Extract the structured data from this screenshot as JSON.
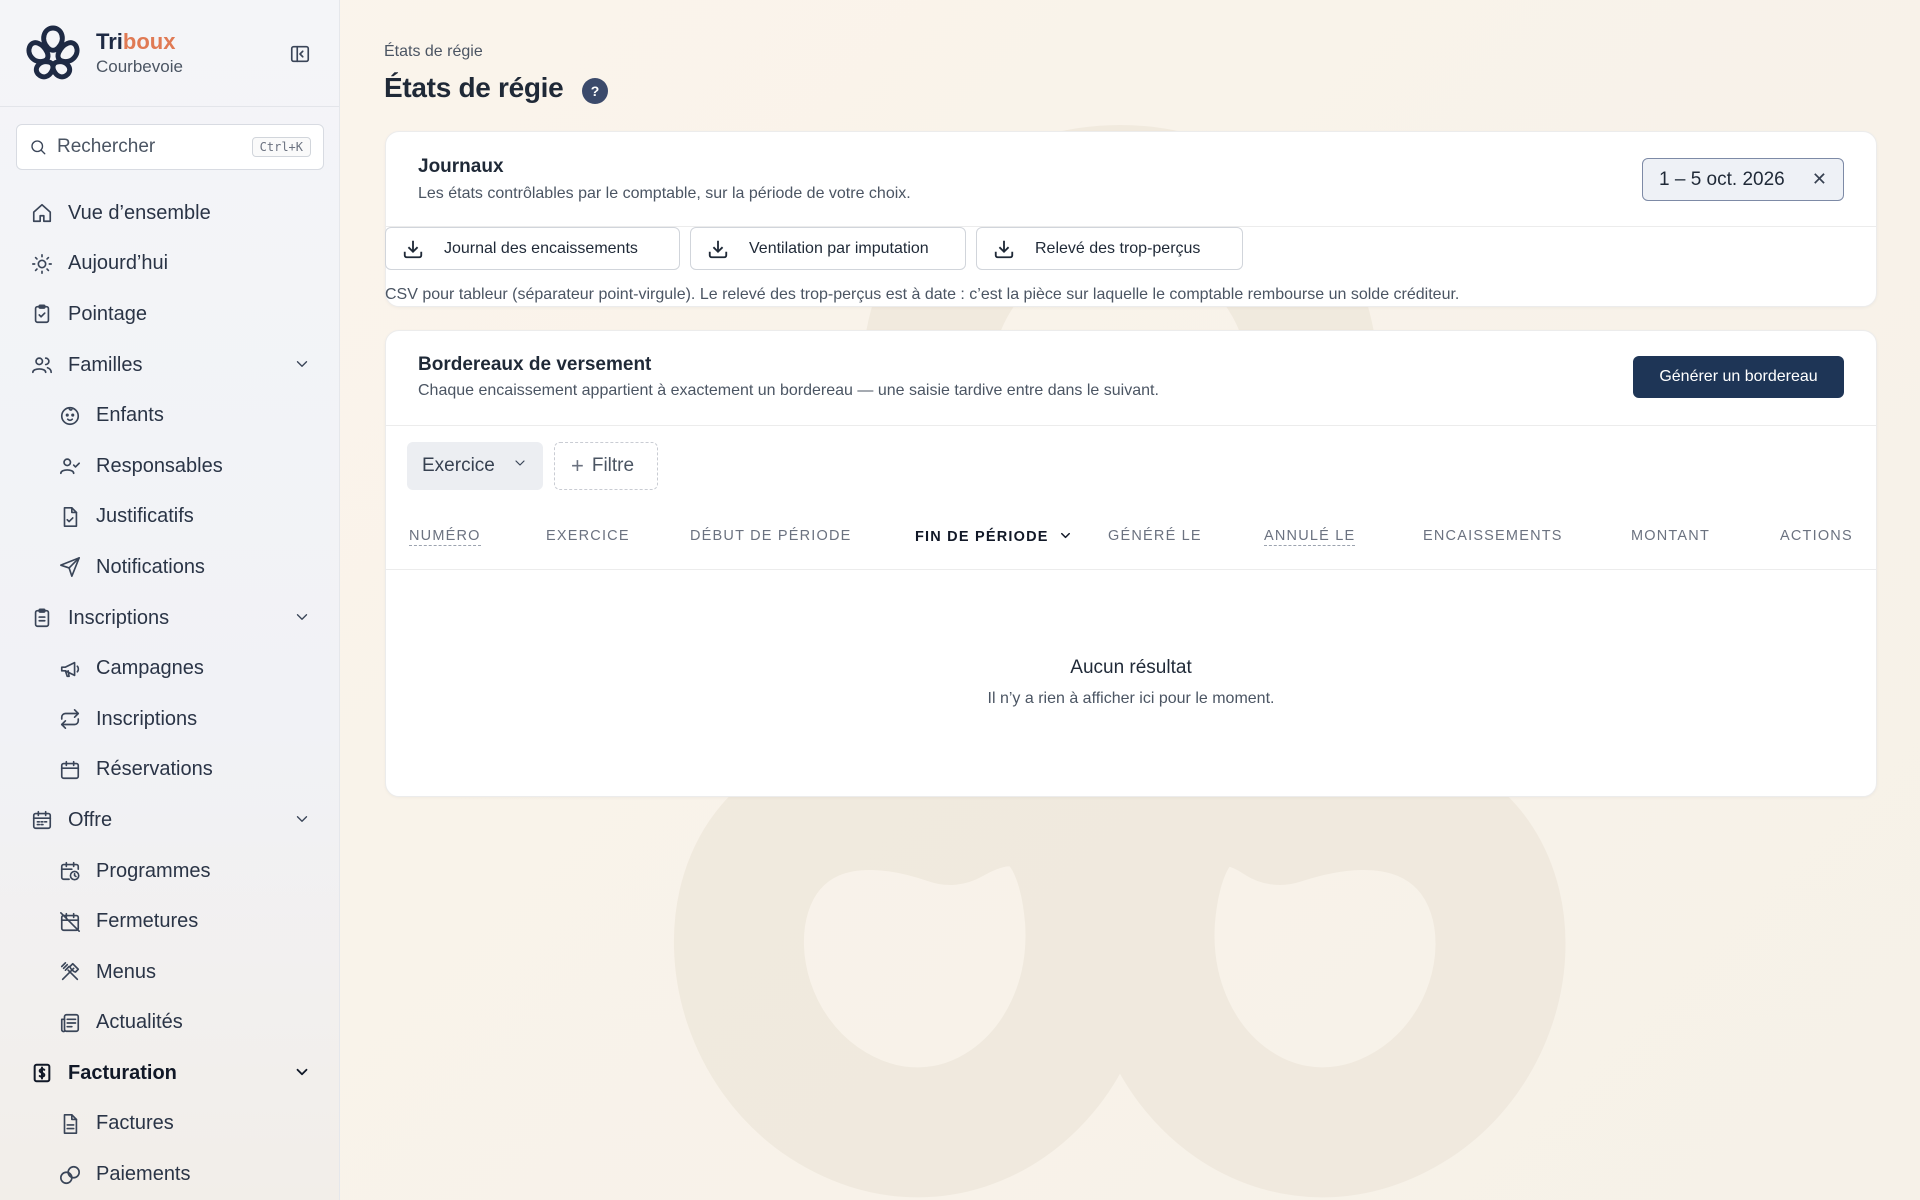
{
  "brand": {
    "name_main": "Tri",
    "name_accent": "boux",
    "city": "Courbevoie"
  },
  "search": {
    "label": "Rechercher",
    "shortcut": "Ctrl+K"
  },
  "sidebar": {
    "items": [
      {
        "label": "Vue d’ensemble"
      },
      {
        "label": "Aujourd’hui"
      },
      {
        "label": "Pointage"
      },
      {
        "label": "Familles"
      },
      {
        "label": "Enfants"
      },
      {
        "label": "Responsables"
      },
      {
        "label": "Justificatifs"
      },
      {
        "label": "Notifications"
      },
      {
        "label": "Inscriptions"
      },
      {
        "label": "Campagnes"
      },
      {
        "label": "Inscriptions"
      },
      {
        "label": "Réservations"
      },
      {
        "label": "Offre"
      },
      {
        "label": "Programmes"
      },
      {
        "label": "Fermetures"
      },
      {
        "label": "Menus"
      },
      {
        "label": "Actualités"
      },
      {
        "label": "Facturation"
      },
      {
        "label": "Factures"
      },
      {
        "label": "Paiements"
      }
    ]
  },
  "header": {
    "breadcrumb": "États de régie",
    "title": "États de régie",
    "help": "?"
  },
  "journaux": {
    "title": "Journaux",
    "subtitle": "Les états contrôlables par le comptable, sur la période de votre choix.",
    "date_range": "1 – 5 oct. 2026",
    "clear": "✕",
    "buttons": [
      "Journal des encaissements",
      "Ventilation par imputation",
      "Relevé des trop-perçus"
    ],
    "note": "CSV pour tableur (séparateur point-virgule). Le relevé des trop-perçus est à date : c’est la pièce sur laquelle le comptable rembourse un solde créditeur."
  },
  "bordereaux": {
    "title": "Bordereaux de versement",
    "subtitle": "Chaque encaissement appartient à exactement un bordereau — une saisie tardive entre dans le suivant.",
    "generate_label": "Générer un bordereau",
    "filter_exercice": "Exercice",
    "filter_add": "Filtre",
    "columns": [
      "Numéro",
      "Exercice",
      "Début de période",
      "Fin de période",
      "Généré le",
      "Annulé le",
      "Encaissements",
      "Montant",
      "Actions"
    ],
    "empty_title": "Aucun résultat",
    "empty_subtitle": "Il n’y a rien à afficher ici pour le moment."
  }
}
